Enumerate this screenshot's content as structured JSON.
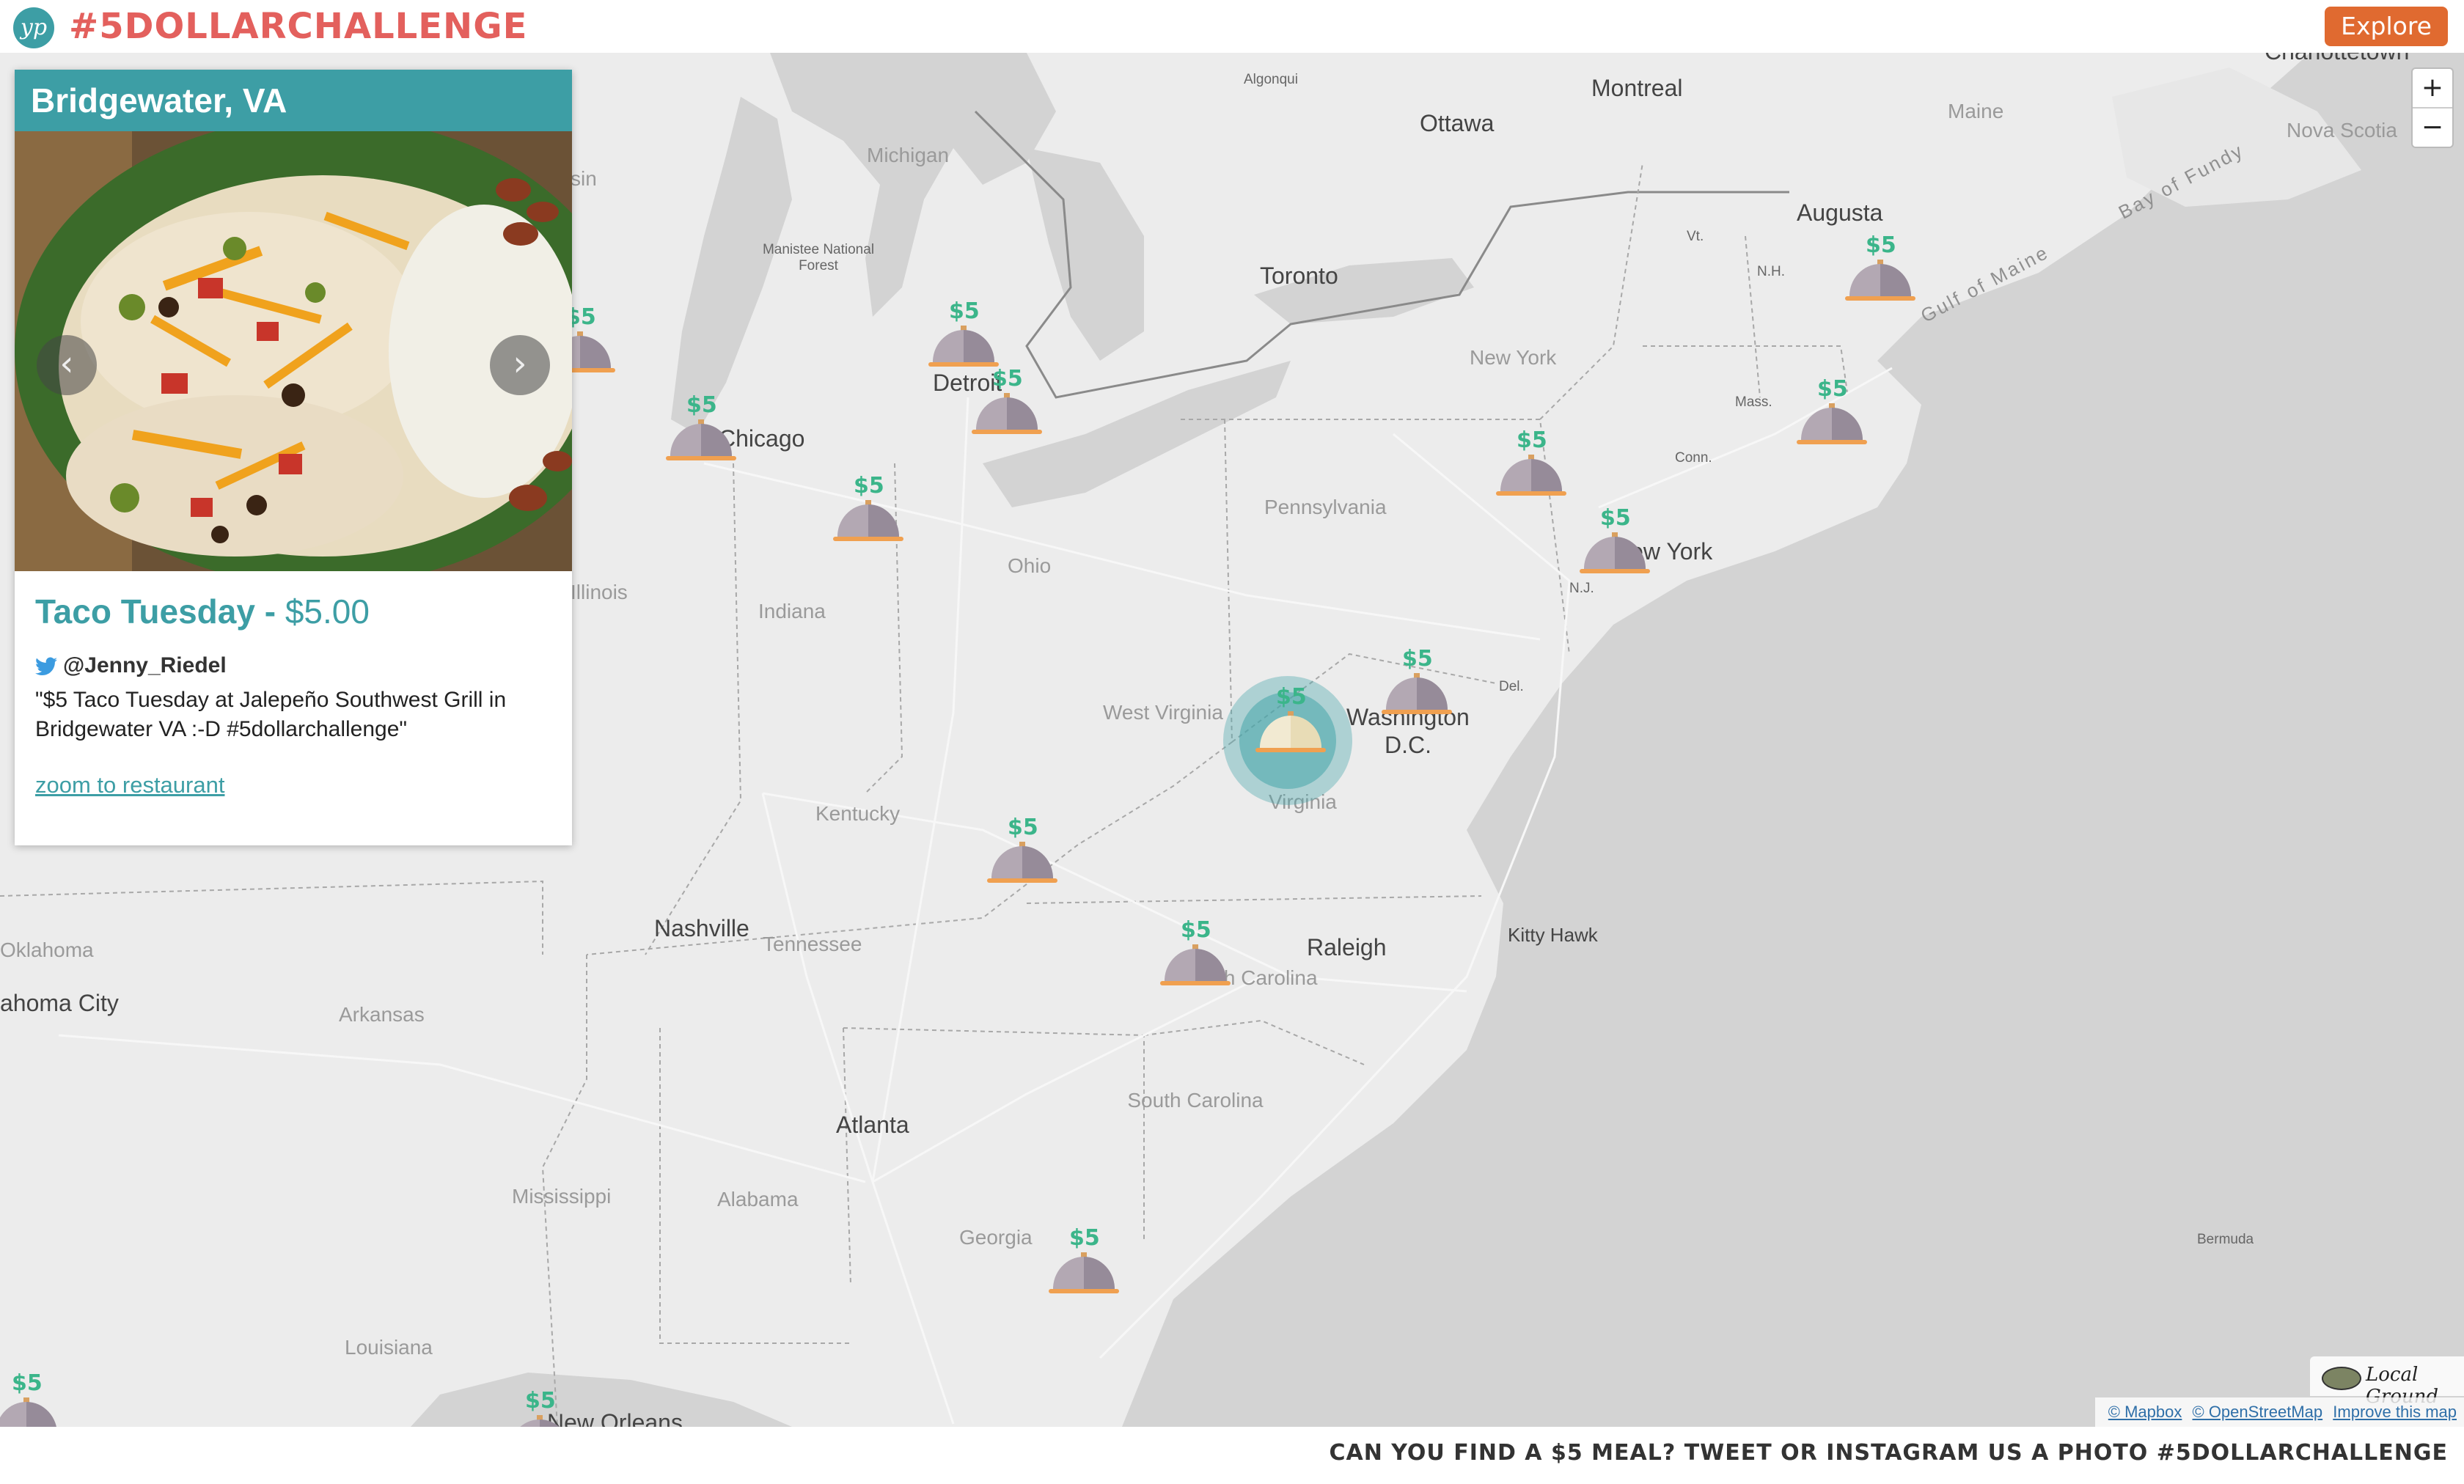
{
  "header": {
    "logo_text": "yp",
    "brand": "#5DOLLARCHALLENGE",
    "explore_label": "Explore"
  },
  "panel": {
    "location": "Bridgewater, VA",
    "meal_name": "Taco Tuesday",
    "separator": " - ",
    "price": "$5.00",
    "username": "@Jenny_Riedel",
    "quote": "\"$5 Taco Tuesday at Jalepeño Southwest Grill in Bridgewater VA :-D #5dollarchallenge\"",
    "zoom_link": "zoom to restaurant",
    "prev_icon": "chevron-left-icon",
    "next_icon": "chevron-right-icon"
  },
  "map": {
    "zoom_in": "+",
    "zoom_out": "−",
    "credit": "Local Ground",
    "attribution": [
      "© Mapbox",
      "© OpenStreetMap",
      "Improve this map"
    ],
    "marker_label": "$5",
    "places": {
      "algonqui": "Algonqui",
      "montreal": "Montreal",
      "ottawa": "Ottawa",
      "charlottetown": "Charlottetown",
      "maine": "Maine",
      "nova_scotia": "Nova Scotia",
      "bay_of_fundy": "Bay of Fundy",
      "augusta": "Augusta",
      "gulf_of_maine": "Gulf of Maine",
      "michigan": "Michigan",
      "manistee": "Manistee National Forest",
      "toronto": "Toronto",
      "vt": "Vt.",
      "nh": "N.H.",
      "new_york_state": "New York",
      "mass": "Mass.",
      "conn": "Conn.",
      "detroit": "Detroit",
      "chicago": "Chicago",
      "pennsylvania": "Pennsylvania",
      "new_york_city": "New York",
      "nj": "N.J.",
      "ohio": "Ohio",
      "indiana": "Indiana",
      "illinois": "Illinois",
      "west_virginia": "West Virginia",
      "washington": "Washington",
      "dc": "D.C.",
      "del": "Del.",
      "virginia": "Virginia",
      "kentucky": "Kentucky",
      "nashville": "Nashville",
      "tennessee": "Tennessee",
      "raleigh": "Raleigh",
      "north_carolina": "North Carolina",
      "kitty_hawk": "Kitty Hawk",
      "oklahoma": "Oklahoma",
      "oklahoma_city": "ahoma City",
      "arkansas": "Arkansas",
      "south_carolina": "South Carolina",
      "atlanta": "Atlanta",
      "mississippi": "Mississippi",
      "alabama": "Alabama",
      "georgia": "Georgia",
      "louisiana": "Louisiana",
      "new_orleans": "New Orleans",
      "bermuda": "Bermuda",
      "sin": "sin"
    }
  },
  "footer": {
    "text": "Can you find a $5 meal? Tweet or Instagram us a photo #5dollarchallenge"
  },
  "colors": {
    "teal": "#3d9ea5",
    "brand_red": "#e3605d",
    "explore_orange": "#e06a30",
    "marker_green": "#3bb58a"
  }
}
